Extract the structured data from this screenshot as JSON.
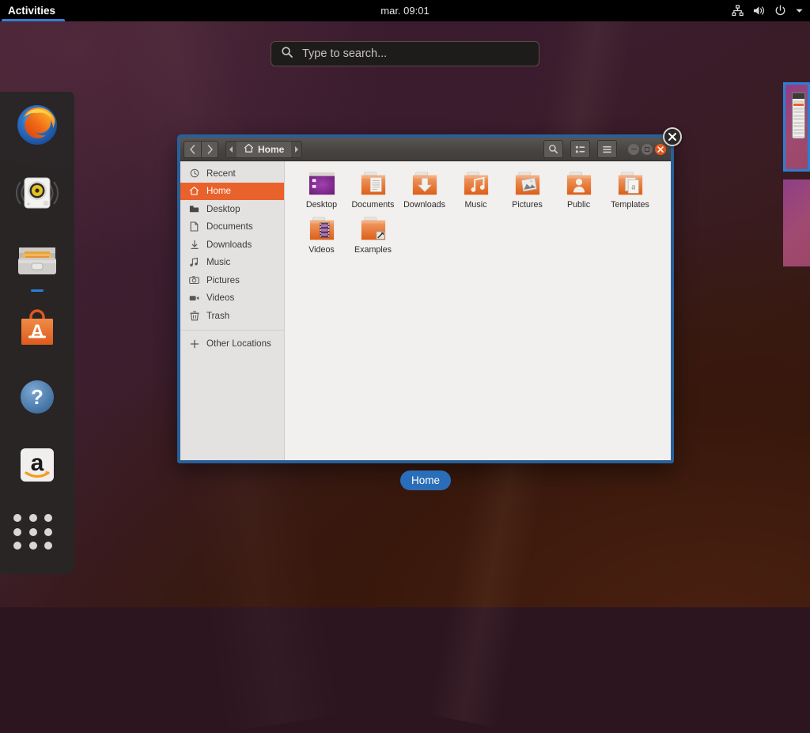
{
  "topbar": {
    "activities_label": "Activities",
    "clock": "mar. 09:01",
    "tray": [
      {
        "name": "network-icon"
      },
      {
        "name": "volume-icon"
      },
      {
        "name": "power-icon"
      },
      {
        "name": "chevron-down-icon"
      }
    ]
  },
  "search": {
    "placeholder": "Type to search...",
    "value": "",
    "icon": "search-icon"
  },
  "dock": {
    "items": [
      {
        "label": "Firefox",
        "icon": "firefox-icon",
        "running": false
      },
      {
        "label": "Rhythmbox",
        "icon": "rhythmbox-icon",
        "running": false
      },
      {
        "label": "Files",
        "icon": "files-icon",
        "running": true
      },
      {
        "label": "Ubuntu Software",
        "icon": "ubuntu-software-icon",
        "running": false
      },
      {
        "label": "Help",
        "icon": "help-icon",
        "running": false
      },
      {
        "label": "Amazon",
        "icon": "amazon-icon",
        "running": false
      },
      {
        "label": "Show Applications",
        "icon": "app-grid-icon",
        "running": false
      }
    ]
  },
  "workspaces": {
    "items": [
      {
        "name": "workspace-1",
        "active": true
      },
      {
        "name": "workspace-2",
        "active": false
      }
    ]
  },
  "window": {
    "caption": "Home",
    "breadcrumb": {
      "icon": "home-icon",
      "label": "Home"
    },
    "titlebar_buttons": {
      "back": "‹",
      "forward": "›",
      "search": "search-icon",
      "view_list": "view-list-icon",
      "menu": "hamburger-menu-icon",
      "minimize": "minimize-icon",
      "maximize": "maximize-icon",
      "close": "close-icon"
    },
    "sidebar": [
      {
        "label": "Recent",
        "icon": "clock-icon",
        "active": false
      },
      {
        "label": "Home",
        "icon": "home-icon",
        "active": true
      },
      {
        "label": "Desktop",
        "icon": "desktop-folder-icon",
        "active": false
      },
      {
        "label": "Documents",
        "icon": "document-icon",
        "active": false
      },
      {
        "label": "Downloads",
        "icon": "download-icon",
        "active": false
      },
      {
        "label": "Music",
        "icon": "music-note-icon",
        "active": false
      },
      {
        "label": "Pictures",
        "icon": "camera-icon",
        "active": false
      },
      {
        "label": "Videos",
        "icon": "video-icon",
        "active": false
      },
      {
        "label": "Trash",
        "icon": "trash-icon",
        "active": false
      }
    ],
    "sidebar_other": {
      "label": "Other Locations",
      "icon": "plus-icon"
    },
    "files": [
      {
        "label": "Desktop",
        "icon": "desktop-window-icon"
      },
      {
        "label": "Documents",
        "icon": "folder-documents-icon"
      },
      {
        "label": "Downloads",
        "icon": "folder-downloads-icon"
      },
      {
        "label": "Music",
        "icon": "folder-music-icon"
      },
      {
        "label": "Pictures",
        "icon": "folder-pictures-icon"
      },
      {
        "label": "Public",
        "icon": "folder-public-icon"
      },
      {
        "label": "Templates",
        "icon": "folder-templates-icon"
      },
      {
        "label": "Videos",
        "icon": "folder-videos-icon"
      },
      {
        "label": "Examples",
        "icon": "folder-examples-link-icon"
      }
    ]
  },
  "colors": {
    "accent_orange": "#e9622c",
    "selection_blue": "#2a6099",
    "caption_blue": "#2a6db8",
    "topbar_black": "#000000",
    "sidebar_bg": "#e4e2e0",
    "files_bg": "#f1f0ee"
  }
}
